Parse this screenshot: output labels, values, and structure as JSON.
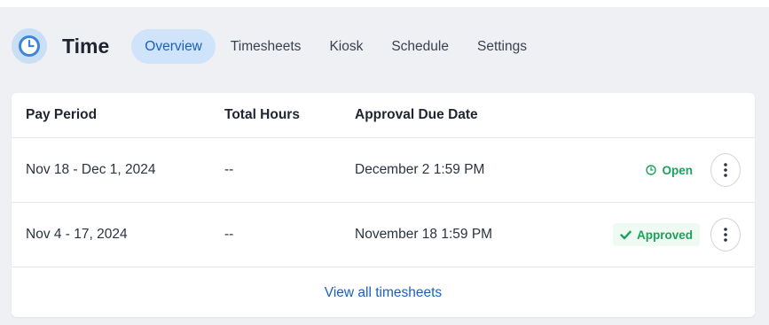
{
  "app": {
    "title": "Time",
    "icon": "clock-icon"
  },
  "tabs": [
    {
      "label": "Overview",
      "active": true
    },
    {
      "label": "Timesheets",
      "active": false
    },
    {
      "label": "Kiosk",
      "active": false
    },
    {
      "label": "Schedule",
      "active": false
    },
    {
      "label": "Settings",
      "active": false
    }
  ],
  "table": {
    "headers": {
      "pay_period": "Pay Period",
      "total_hours": "Total Hours",
      "due_date": "Approval Due Date"
    },
    "rows": [
      {
        "pay_period": "Nov 18 - Dec 1, 2024",
        "total_hours": "--",
        "due_date": "December 2 1:59 PM",
        "status": "Open",
        "status_icon": "clock-icon"
      },
      {
        "pay_period": "Nov 4 - 17, 2024",
        "total_hours": "--",
        "due_date": "November 18 1:59 PM",
        "status": "Approved",
        "status_icon": "check-icon"
      }
    ]
  },
  "footer": {
    "view_all": "View all timesheets"
  },
  "colors": {
    "accent": "#1a5fbf",
    "success": "#1ca25a",
    "background": "#eef0f4"
  }
}
